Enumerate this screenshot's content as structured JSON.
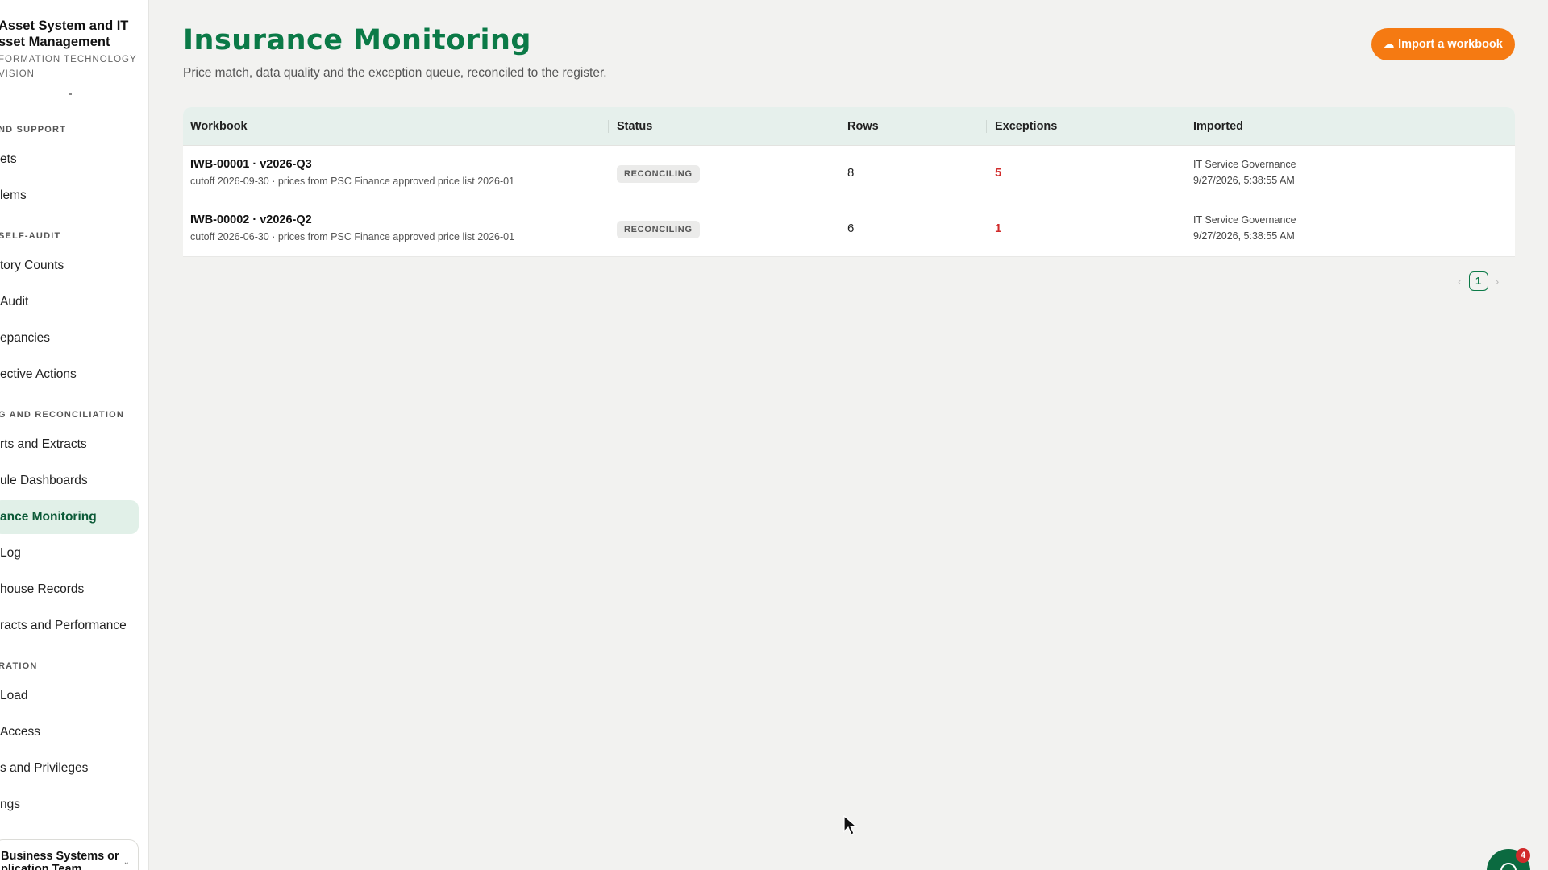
{
  "brand": {
    "title_line1": "Asset System and IT",
    "title_line2": "sset Management",
    "sub_line1": "FORMATION TECHNOLOGY",
    "sub_line2": "VISION"
  },
  "sidebar": {
    "sections": [
      {
        "label": "ND SUPPORT"
      },
      {
        "label": "SELF-AUDIT"
      },
      {
        "label": "G AND RECONCILIATION"
      },
      {
        "label": "RATION"
      }
    ],
    "items": [
      {
        "label": "ets"
      },
      {
        "label": "lems"
      },
      {
        "label": "tory Counts"
      },
      {
        "label": "Audit"
      },
      {
        "label": "epancies"
      },
      {
        "label": "ective Actions"
      },
      {
        "label": "rts and Extracts"
      },
      {
        "label": "ule Dashboards"
      },
      {
        "label": "ance Monitoring"
      },
      {
        "label": "Log"
      },
      {
        "label": "house Records"
      },
      {
        "label": "racts and Performance"
      },
      {
        "label": "Load"
      },
      {
        "label": "Access"
      },
      {
        "label": "s and Privileges"
      },
      {
        "label": "ngs"
      }
    ],
    "team": {
      "line1": "Business Systems or",
      "line2": "plication Team"
    }
  },
  "header": {
    "title": "Insurance Monitoring",
    "subtitle": "Price match, data quality and the exception queue, reconciled to the register.",
    "import_label": "Import a workbook",
    "import_icon": "cloud-upload-icon"
  },
  "table": {
    "columns": [
      "Workbook",
      "Status",
      "Rows",
      "Exceptions",
      "Imported"
    ],
    "rows": [
      {
        "workbook": "IWB-00001 · v2026-Q3",
        "detail": "cutoff 2026-09-30 · prices from PSC Finance approved price list 2026-01",
        "status": "RECONCILING",
        "rows": "8",
        "exceptions": "5",
        "imported_by": "IT Service Governance",
        "imported_at": "9/27/2026, 5:38:55 AM"
      },
      {
        "workbook": "IWB-00002 · v2026-Q2",
        "detail": "cutoff 2026-06-30 · prices from PSC Finance approved price list 2026-01",
        "status": "RECONCILING",
        "rows": "6",
        "exceptions": "1",
        "imported_by": "IT Service Governance",
        "imported_at": "9/27/2026, 5:38:55 AM"
      }
    ]
  },
  "pagination": {
    "prev": "‹",
    "current": "1",
    "next": "›"
  },
  "chat": {
    "badge": "4",
    "icon": "chat-icon"
  },
  "colors": {
    "accent": "#0b7a47",
    "button": "#f57a12",
    "danger": "#d12b2b",
    "active_bg": "#e1f0e8"
  }
}
